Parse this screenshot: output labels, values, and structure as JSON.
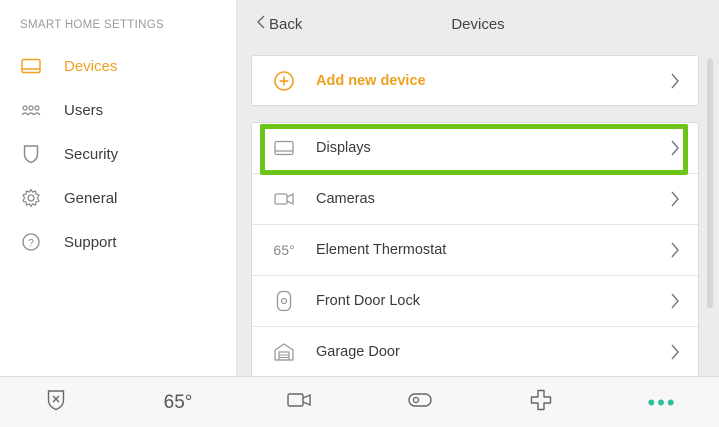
{
  "sidebar": {
    "heading": "SMART HOME SETTINGS",
    "items": [
      {
        "label": "Devices",
        "icon": "display-icon",
        "active": true
      },
      {
        "label": "Users",
        "icon": "users-icon"
      },
      {
        "label": "Security",
        "icon": "shield-icon"
      },
      {
        "label": "General",
        "icon": "gear-icon"
      },
      {
        "label": "Support",
        "icon": "question-circle-icon"
      }
    ]
  },
  "header": {
    "back_label": "Back",
    "title": "Devices"
  },
  "add_device": {
    "label": "Add new device",
    "icon": "plus-circle-icon"
  },
  "devices": [
    {
      "label": "Displays",
      "icon": "display-icon",
      "highlighted": true
    },
    {
      "label": "Cameras",
      "icon": "camera-icon"
    },
    {
      "label": "Element Thermostat",
      "icon_text": "65°"
    },
    {
      "label": "Front Door Lock",
      "icon": "lock-icon"
    },
    {
      "label": "Garage Door",
      "icon": "garage-icon"
    }
  ],
  "bottom_bar": {
    "temperature": "65°",
    "dots": "•••"
  },
  "colors": {
    "accent": "#f0a020",
    "highlight": "#6cc417",
    "dots": "#2bbf9a"
  }
}
